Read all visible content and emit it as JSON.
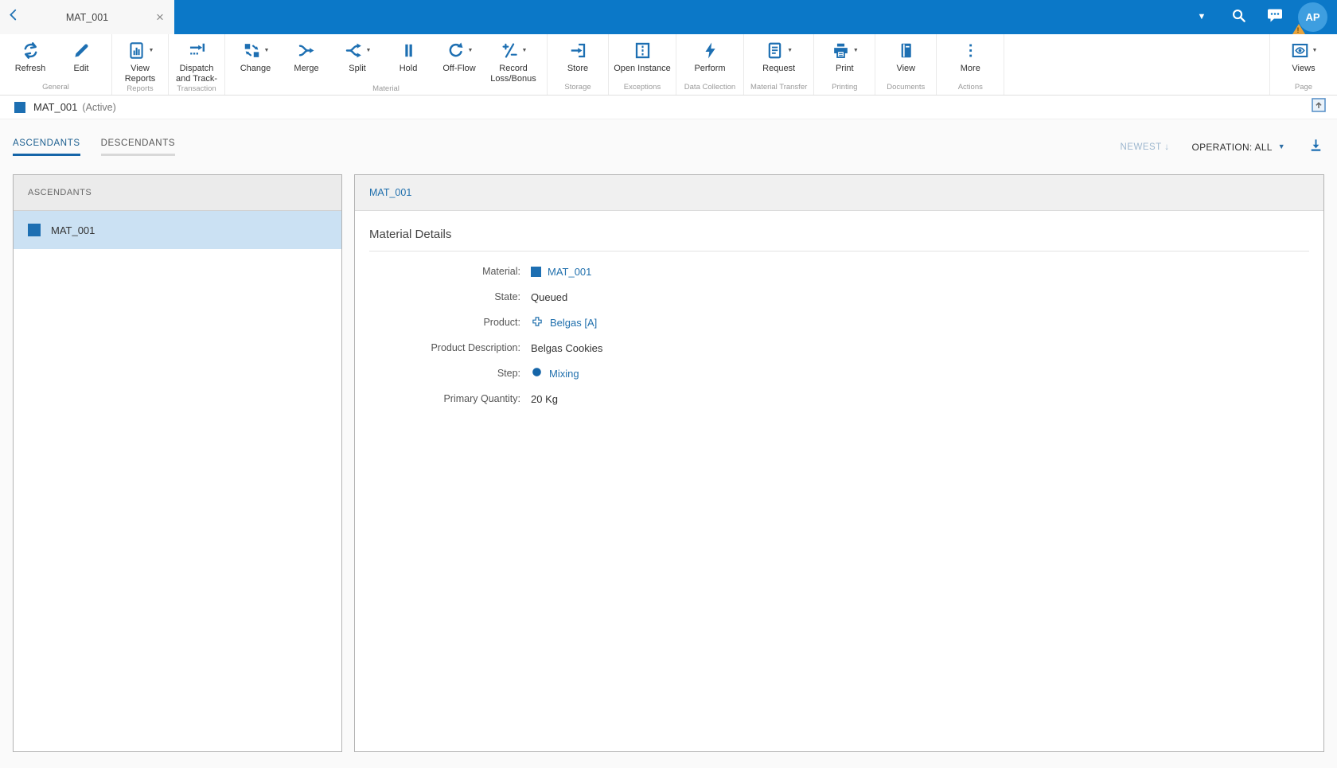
{
  "colors": {
    "topbar_blue": "#0b78c8",
    "icon_blue": "#1d6fb2",
    "link_blue": "#2170ad",
    "avatar_blue": "#3e9ee0",
    "selected_row_bg": "#cbe1f3",
    "warning_orange": "#e8a33d",
    "active_tab_underline": "#1565a8"
  },
  "icons": {
    "caret_down": "▼",
    "arrow_down": "↓",
    "close": "×",
    "warning": "!"
  },
  "topbar": {
    "tab_title": "MAT_001",
    "avatar_initials": "AP"
  },
  "toolbar": {
    "groups": [
      {
        "label": "General",
        "items": [
          {
            "label": "Refresh"
          },
          {
            "label": "Edit"
          }
        ]
      },
      {
        "label": "Reports",
        "items": [
          {
            "label": "View Reports",
            "dropdown": true
          }
        ]
      },
      {
        "label": "Transaction",
        "items": [
          {
            "label": "Dispatch and Track-"
          }
        ]
      },
      {
        "label": "Material",
        "items": [
          {
            "label": "Change",
            "dropdown": true
          },
          {
            "label": "Merge"
          },
          {
            "label": "Split",
            "dropdown": true
          },
          {
            "label": "Hold"
          },
          {
            "label": "Off-Flow",
            "dropdown": true
          },
          {
            "label": "Record Loss/Bonus",
            "dropdown": true
          }
        ]
      },
      {
        "label": "Storage",
        "items": [
          {
            "label": "Store"
          }
        ]
      },
      {
        "label": "Exceptions",
        "items": [
          {
            "label": "Open Instance"
          }
        ]
      },
      {
        "label": "Data Collection",
        "items": [
          {
            "label": "Perform"
          }
        ]
      },
      {
        "label": "Material Transfer",
        "items": [
          {
            "label": "Request",
            "dropdown": true
          }
        ]
      },
      {
        "label": "Printing",
        "items": [
          {
            "label": "Print",
            "dropdown": true
          }
        ]
      },
      {
        "label": "Documents",
        "items": [
          {
            "label": "View"
          }
        ]
      },
      {
        "label": "Actions",
        "items": [
          {
            "label": "More"
          }
        ]
      },
      {
        "label": "Page",
        "items": [
          {
            "label": "Views",
            "dropdown": true
          }
        ]
      }
    ]
  },
  "title_bar": {
    "name": "MAT_001",
    "status": "(Active)"
  },
  "tabs": {
    "items": [
      {
        "label": "ASCENDANTS",
        "active": true
      },
      {
        "label": "DESCENDANTS",
        "active": false
      }
    ]
  },
  "filters": {
    "sort_label": "NEWEST",
    "operation_label": "OPERATION: ALL"
  },
  "left_panel": {
    "header": "ASCENDANTS",
    "items": [
      {
        "label": "MAT_001",
        "selected": true
      }
    ]
  },
  "details_panel": {
    "header": "MAT_001",
    "section_title": "Material Details",
    "fields": [
      {
        "label": "Material:",
        "value": "MAT_001",
        "icon": "material-square",
        "link": true
      },
      {
        "label": "State:",
        "value": "Queued"
      },
      {
        "label": "Product:",
        "value": "Belgas [A]",
        "icon": "product-cross",
        "link": true
      },
      {
        "label": "Product Description:",
        "value": "Belgas Cookies"
      },
      {
        "label": "Step:",
        "value": "Mixing",
        "icon": "step-circle",
        "link": true
      },
      {
        "label": "Primary Quantity:",
        "value": "20 Kg"
      }
    ]
  }
}
